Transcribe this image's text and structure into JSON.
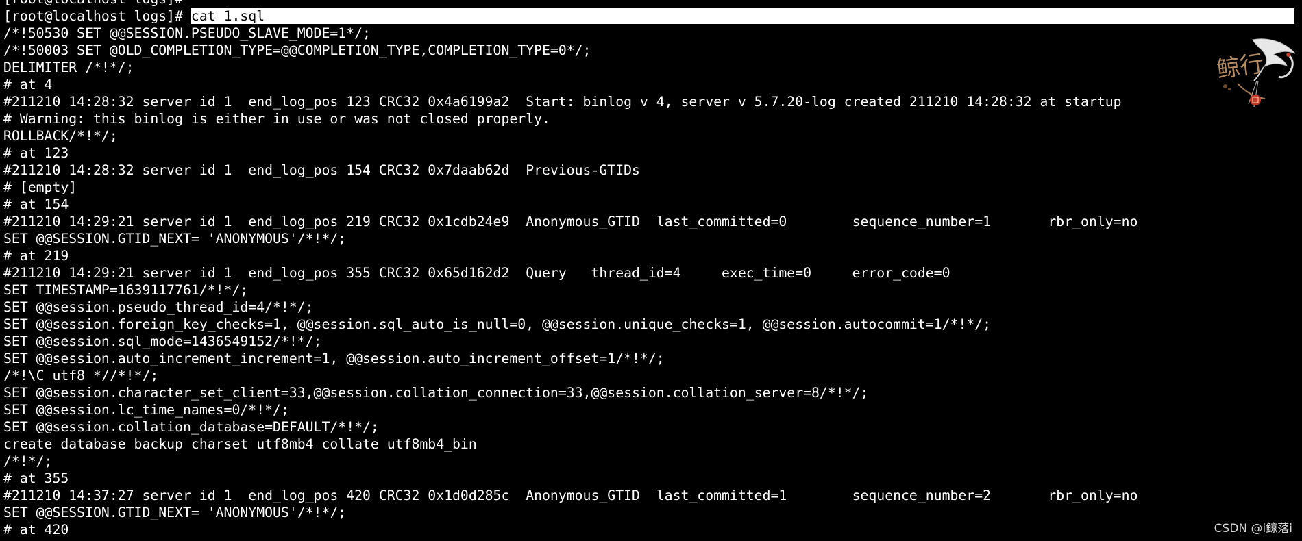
{
  "terminal": {
    "prompt_top": "[root@localhost logs]#",
    "prompt": "[root@localhost logs]# ",
    "command": "cat 1.sql",
    "lines": [
      "/*!50530 SET @@SESSION.PSEUDO_SLAVE_MODE=1*/;",
      "/*!50003 SET @OLD_COMPLETION_TYPE=@@COMPLETION_TYPE,COMPLETION_TYPE=0*/;",
      "DELIMITER /*!*/;",
      "# at 4",
      "#211210 14:28:32 server id 1  end_log_pos 123 CRC32 0x4a6199a2  Start: binlog v 4, server v 5.7.20-log created 211210 14:28:32 at startup",
      "# Warning: this binlog is either in use or was not closed properly.",
      "ROLLBACK/*!*/;",
      "# at 123",
      "#211210 14:28:32 server id 1  end_log_pos 154 CRC32 0x7daab62d  Previous-GTIDs",
      "# [empty]",
      "# at 154",
      "#211210 14:29:21 server id 1  end_log_pos 219 CRC32 0x1cdb24e9  Anonymous_GTID  last_committed=0        sequence_number=1       rbr_only=no",
      "SET @@SESSION.GTID_NEXT= 'ANONYMOUS'/*!*/;",
      "# at 219",
      "#211210 14:29:21 server id 1  end_log_pos 355 CRC32 0x65d162d2  Query   thread_id=4     exec_time=0     error_code=0",
      "SET TIMESTAMP=1639117761/*!*/;",
      "SET @@session.pseudo_thread_id=4/*!*/;",
      "SET @@session.foreign_key_checks=1, @@session.sql_auto_is_null=0, @@session.unique_checks=1, @@session.autocommit=1/*!*/;",
      "SET @@session.sql_mode=1436549152/*!*/;",
      "SET @@session.auto_increment_increment=1, @@session.auto_increment_offset=1/*!*/;",
      "/*!\\C utf8 *//*!*/;",
      "SET @@session.character_set_client=33,@@session.collation_connection=33,@@session.collation_server=8/*!*/;",
      "SET @@session.lc_time_names=0/*!*/;",
      "SET @@session.collation_database=DEFAULT/*!*/;",
      "create database backup charset utf8mb4 collate utf8mb4_bin",
      "/*!*/;",
      "# at 355",
      "#211210 14:37:27 server id 1  end_log_pos 420 CRC32 0x1d0d285c  Anonymous_GTID  last_committed=1        sequence_number=2       rbr_only=no",
      "SET @@SESSION.GTID_NEXT= 'ANONYMOUS'/*!*/;",
      "# at 420"
    ]
  },
  "watermark": {
    "logo_text": "鲸行",
    "text": "CSDN @i鲸落i"
  },
  "colors": {
    "background": "#000000",
    "foreground": "#ffffff",
    "selection_bg": "#ffffff",
    "selection_fg": "#000000",
    "seal_red": "#c0392b"
  }
}
